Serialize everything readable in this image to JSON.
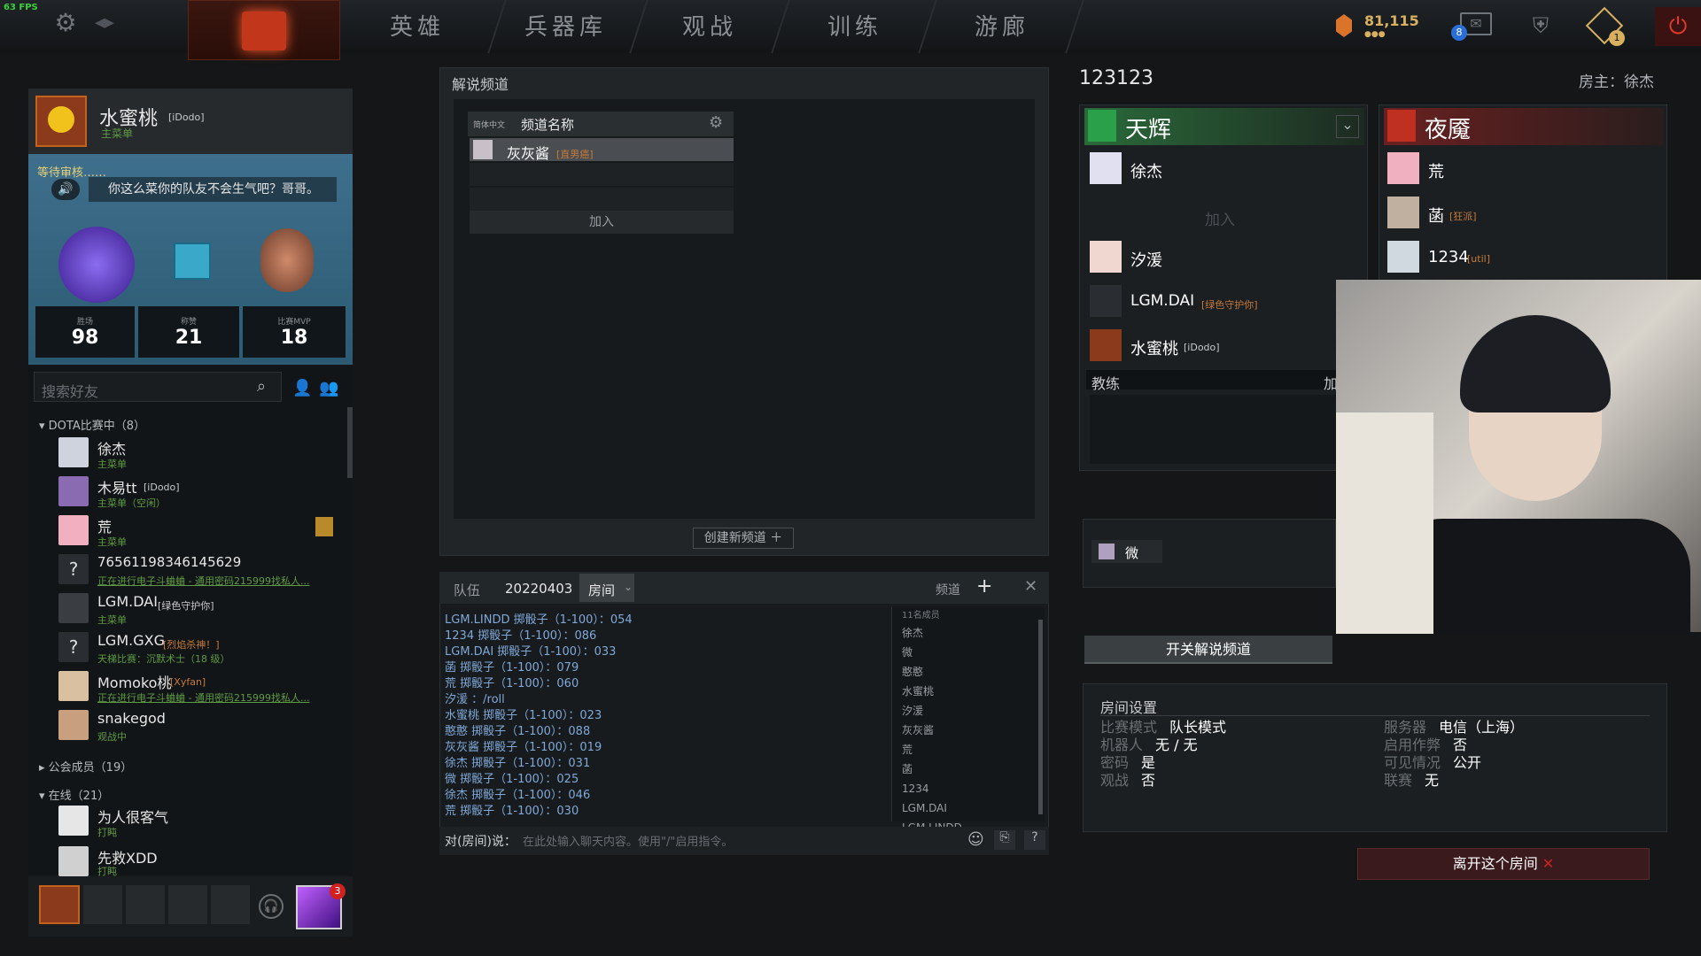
{
  "fps": "63 FPS",
  "nav": {
    "tabs": [
      "英雄",
      "兵器库",
      "观战",
      "训练",
      "游廊"
    ]
  },
  "topbar": {
    "currency": "81,115",
    "mail_badge": "8",
    "quest_badge": "1"
  },
  "profile": {
    "name": "水蜜桃",
    "tag": "[iDodo]",
    "status": "主菜单",
    "waiting": "等待审核……",
    "quote": "你这么菜你的队友不会生气吧？哥哥。",
    "stats": [
      {
        "label": "胜场",
        "value": "98"
      },
      {
        "label": "称赞",
        "value": "21"
      },
      {
        "label": "比赛MVP",
        "value": "18"
      }
    ]
  },
  "friends": {
    "search_placeholder": "搜索好友",
    "group1": "DOTA比赛中（8）",
    "list": [
      {
        "name": "徐杰",
        "tag": "",
        "status": "主菜单"
      },
      {
        "name": "木易tt",
        "tag": "[iDodo]",
        "status": "主菜单（空闲）"
      },
      {
        "name": "荒",
        "tag": "",
        "status": "主菜单"
      },
      {
        "name": "76561198346145629",
        "tag": "",
        "status": "正在进行电子斗蛐蛐 - 通用密码215999找私人..."
      },
      {
        "name": "LGM.DAI",
        "tag": "[绿色守护你]",
        "status": "主菜单"
      },
      {
        "name": "LGM.GXG",
        "tag": "[烈焰杀神！]",
        "status": "天梯比赛：沉默术士（18 级）"
      },
      {
        "name": "Momoko桃",
        "tag": "[Xyfan]",
        "status": "正在进行电子斗蛐蛐 - 通用密码215999找私人..."
      },
      {
        "name": "snakegod",
        "tag": "",
        "status": "观战中"
      }
    ],
    "group2": "公会成员（19）",
    "group3": "在线（21）",
    "online": [
      {
        "name": "为人很客气",
        "status": "打盹"
      },
      {
        "name": "先救XDD",
        "status": "打盹"
      }
    ],
    "party_badge": "3"
  },
  "commentary": {
    "title": "解说频道",
    "lang": "简体中文",
    "col_name": "频道名称",
    "channel": "灰灰酱",
    "channel_tag": "[直男癌]",
    "join": "加入",
    "create": "创建新频道"
  },
  "chat": {
    "tabs": [
      "队伍",
      "20220403",
      "房间"
    ],
    "channel_label": "频道",
    "member_count": "11名成员",
    "lines": [
      "LGM.LINDD 掷骰子（1-100）：054",
      "1234 掷骰子（1-100）：086",
      "LGM.DAI 掷骰子（1-100）：033",
      "菡 掷骰子（1-100）：079",
      "荒 掷骰子（1-100）：060",
      "汐湲 ：/roll",
      "水蜜桃 掷骰子（1-100）：023",
      "憨憨 掷骰子（1-100）：088",
      "灰灰酱 掷骰子（1-100）：019",
      "徐杰 掷骰子（1-100）：031",
      "微 掷骰子（1-100）：025",
      "徐杰 掷骰子（1-100）：046",
      "荒 掷骰子（1-100）：030"
    ],
    "members": [
      "徐杰",
      "微",
      "憨憨",
      "水蜜桃",
      "汐湲",
      "灰灰酱",
      "荒",
      "菡",
      "1234",
      "LGM.DAI",
      "LGM.LINDD"
    ],
    "input_label": "对(房间)说：",
    "input_placeholder": "在此处输入聊天内容。使用\"/\"启用指令。"
  },
  "lobby": {
    "name": "123123",
    "host": "房主：徐杰",
    "radiant": {
      "title": "天辉",
      "players": [
        {
          "name": "徐杰",
          "tag": ""
        },
        {
          "name": "加入",
          "tag": ""
        },
        {
          "name": "汐湲",
          "tag": ""
        },
        {
          "name": "LGM.DAI",
          "tag": "[绿色守护你]"
        },
        {
          "name": "水蜜桃",
          "tag": "[iDodo]"
        }
      ]
    },
    "dire": {
      "title": "夜魇",
      "players": [
        {
          "name": "荒",
          "tag": ""
        },
        {
          "name": "菡",
          "tag": "[狂派]"
        },
        {
          "name": "1234",
          "tag": "[util]"
        }
      ]
    },
    "coach": "教练",
    "coach_join": "加",
    "unassigned": "微",
    "toggle_btn": "开关解说频道",
    "settings": {
      "title": "房间设置",
      "left": [
        {
          "k": "比赛模式",
          "v": "队长模式"
        },
        {
          "k": "机器人",
          "v": "无 / 无"
        },
        {
          "k": "密码",
          "v": "是"
        },
        {
          "k": "观战",
          "v": "否"
        }
      ],
      "right": [
        {
          "k": "服务器",
          "v": "电信（上海）"
        },
        {
          "k": "启用作弊",
          "v": "否"
        },
        {
          "k": "可见情况",
          "v": "公开"
        },
        {
          "k": "联赛",
          "v": "无"
        }
      ]
    },
    "leave": "离开这个房间"
  }
}
